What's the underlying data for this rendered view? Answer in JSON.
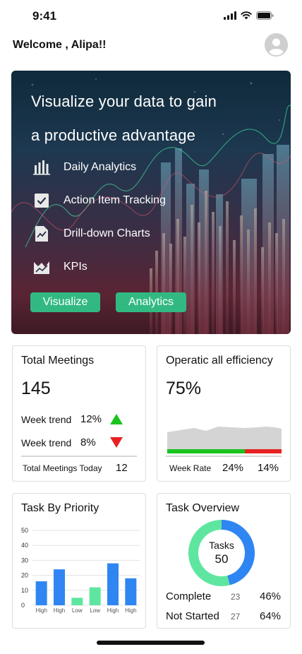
{
  "status_bar": {
    "time": "9:41"
  },
  "greeting": "Welcome , Alipa!!",
  "hero": {
    "title_line1": "Visualize your data to gain",
    "title_line2": "a productive advantage",
    "features": [
      {
        "label": "Daily Analytics",
        "icon": "bar-chart-icon"
      },
      {
        "label": "Action Item Tracking",
        "icon": "checkbox-icon"
      },
      {
        "label": "Drill-down Charts",
        "icon": "chart-document-icon"
      },
      {
        "label": "KPIs",
        "icon": "kpi-area-icon"
      }
    ],
    "buttons": {
      "visualize": "Visualize",
      "analytics": "Analytics"
    },
    "button_color": "#32b982"
  },
  "total_meetings": {
    "title": "Total Meetings",
    "value": "145",
    "trend_up": {
      "label": "Week trend",
      "value": "12%",
      "direction": "up",
      "color": "#19c41f"
    },
    "trend_down": {
      "label": "Week trend",
      "value": "8%",
      "direction": "down",
      "color": "#e82222"
    },
    "today_label": "Total Meetings Today",
    "today_value": "12"
  },
  "efficiency": {
    "title": "Operatic all efficiency",
    "value": "75%",
    "week_rate_label": "Week Rate",
    "green_rate": "24%",
    "red_rate": "14%",
    "green_share": 0.68,
    "green_color": "#19c41f",
    "red_color": "#e82222"
  },
  "task_priority": {
    "title": "Task By Priority",
    "chart_data": {
      "type": "bar",
      "categories": [
        "High",
        "High",
        "Low",
        "Low",
        "High",
        "High"
      ],
      "values": [
        16,
        24,
        5,
        12,
        28,
        18
      ],
      "colors": [
        "#2f86f2",
        "#2f86f2",
        "#5ee6a0",
        "#5ee6a0",
        "#2f86f2",
        "#2f86f2"
      ],
      "yticks": [
        0,
        10,
        20,
        30,
        40,
        50
      ],
      "ylim": [
        0,
        50
      ],
      "grid": true
    }
  },
  "task_overview": {
    "title": "Task Overview",
    "center_label": "Tasks",
    "center_value": "50",
    "chart_data": {
      "type": "pie",
      "labels": [
        "Complete",
        "Not Started"
      ],
      "values": [
        23,
        27
      ],
      "colors": [
        "#2f86f2",
        "#5ee6a0"
      ]
    },
    "rows": [
      {
        "label": "Complete",
        "count": "23",
        "percent": "46%"
      },
      {
        "label": "Not Started",
        "count": "27",
        "percent": "64%"
      }
    ]
  }
}
